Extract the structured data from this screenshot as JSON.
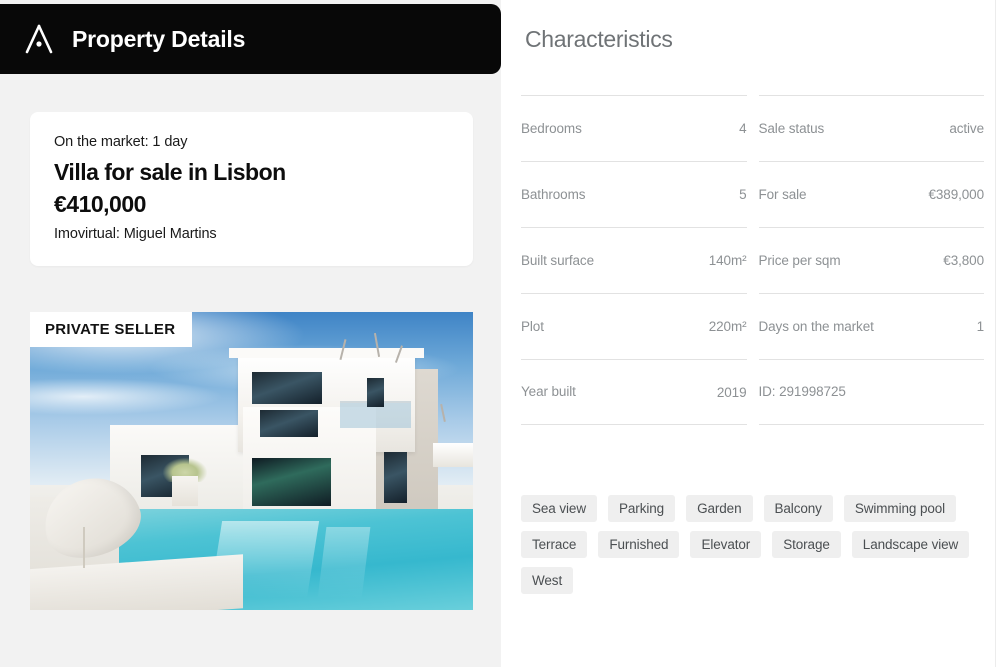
{
  "header": {
    "title": "Property Details",
    "logo_icon": "chevron-a-logo-icon",
    "background_color": "#080808"
  },
  "listing": {
    "market_line": "On the market: 1 day",
    "title": "Villa for sale in Lisbon",
    "price": "€410,000",
    "agent_line": "Imovirtual: Miguel Martins",
    "photo_badge": "PRIVATE SELLER",
    "photo_alt": "Modern white villa with swimming pool under blue sky"
  },
  "characteristics": {
    "title": "Characteristics",
    "left_column": [
      {
        "label": "Bedrooms",
        "value": "4"
      },
      {
        "label": "Bathrooms",
        "value": "5"
      },
      {
        "label": "Built surface",
        "value": "140m²"
      },
      {
        "label": "Plot",
        "value": "220m²"
      },
      {
        "label": "Year built",
        "value": "2019"
      }
    ],
    "right_column": [
      {
        "label": "Sale status",
        "value": "active"
      },
      {
        "label": "For sale",
        "value": "€389,000"
      },
      {
        "label": "Price per sqm",
        "value": "€3,800"
      },
      {
        "label": "Days on the market",
        "value": "1"
      },
      {
        "label": "ID: 291998725",
        "value": ""
      }
    ]
  },
  "tags": [
    "Sea view",
    "Parking",
    "Garden",
    "Balcony",
    "Swimming pool",
    "Terrace",
    "Furnished",
    "Elevator",
    "Storage",
    "Landscape view",
    "West"
  ],
  "colors": {
    "panel_background": "#f2f2f2",
    "card_background": "#ffffff",
    "muted_text": "#8d9194",
    "divider": "#e2e2e2",
    "tag_background": "#efefef"
  }
}
